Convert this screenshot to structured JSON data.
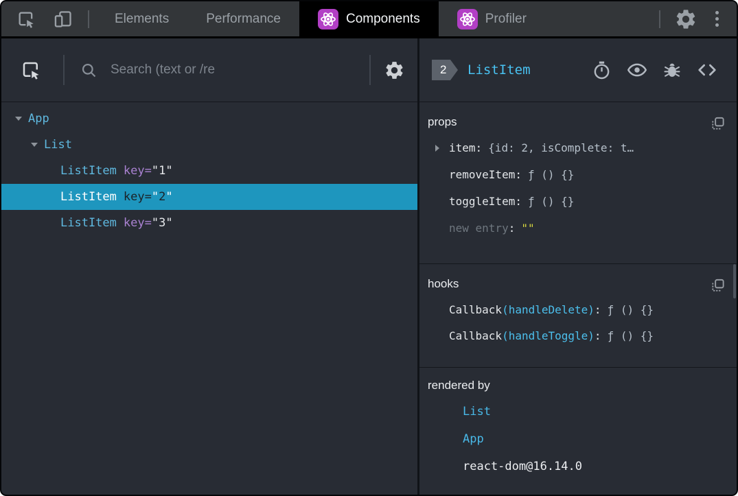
{
  "chrome_bar": {
    "tabs": [
      {
        "label": "Elements"
      },
      {
        "label": "Performance"
      },
      {
        "label": "Components",
        "active": true,
        "react_icon": true
      },
      {
        "label": "Profiler",
        "react_icon": true
      }
    ]
  },
  "left_panel": {
    "search": {
      "placeholder": "Search (text or /re"
    },
    "tree": [
      {
        "label": "App",
        "depth": 0,
        "expanded": true
      },
      {
        "label": "List",
        "depth": 1,
        "expanded": true
      },
      {
        "label": "ListItem",
        "depth": 2,
        "attr_name": "key",
        "attr_value": "1"
      },
      {
        "label": "ListItem",
        "depth": 2,
        "attr_name": "key",
        "attr_value": "2",
        "selected": true
      },
      {
        "label": "ListItem",
        "depth": 2,
        "attr_name": "key",
        "attr_value": "3"
      }
    ]
  },
  "right_panel": {
    "header": {
      "badge": "2",
      "title": "ListItem"
    },
    "props": {
      "label": "props",
      "rows": [
        {
          "name": "item",
          "value": "{id: 2, isComplete: t…",
          "expandable": true
        },
        {
          "name": "removeItem",
          "value": "ƒ () {}"
        },
        {
          "name": "toggleItem",
          "value": "ƒ () {}"
        }
      ],
      "new_entry": {
        "name": "new entry",
        "value": "\"\""
      }
    },
    "hooks": {
      "label": "hooks",
      "rows": [
        {
          "fn": "Callback",
          "hook": "(handleDelete)",
          "value": "ƒ () {}"
        },
        {
          "fn": "Callback",
          "hook": "(handleToggle)",
          "value": "ƒ () {}"
        }
      ]
    },
    "rendered_by": {
      "label": "rendered by",
      "items": [
        {
          "label": "List",
          "link": true
        },
        {
          "label": "App",
          "link": true
        },
        {
          "label": "react-dom@16.14.0",
          "link": false
        }
      ]
    }
  },
  "syntax": {
    "eq": "=",
    "colon": ":",
    "quote": "\""
  },
  "icons": {
    "chrome": [
      "inspect-element-icon",
      "device-toolbar-icon",
      "react-logo-icon",
      "settings-gear-icon",
      "more-options-icon"
    ],
    "left_toolbar": [
      "inspect-component-icon",
      "search-icon",
      "settings-gear-icon"
    ],
    "right_header": [
      "stopwatch-icon",
      "eye-icon",
      "bug-icon",
      "view-source-icon"
    ],
    "sections": [
      "copy-icon"
    ]
  },
  "colors": {
    "chrome_bar_bg": "#333639",
    "active_tab_bg": "#000000",
    "panel_bg": "#282c34",
    "selected_row_bg": "#1e96be",
    "component_cyan": "#5fb9e0",
    "accent_cyan": "#49c2f2",
    "attr_purple": "#aa82d2",
    "value_gray": "#b6c0ca",
    "new_entry_yellow": "#d8d840",
    "react_logo_purple": "#b23fc5",
    "badge_bg": "#5c626b"
  }
}
